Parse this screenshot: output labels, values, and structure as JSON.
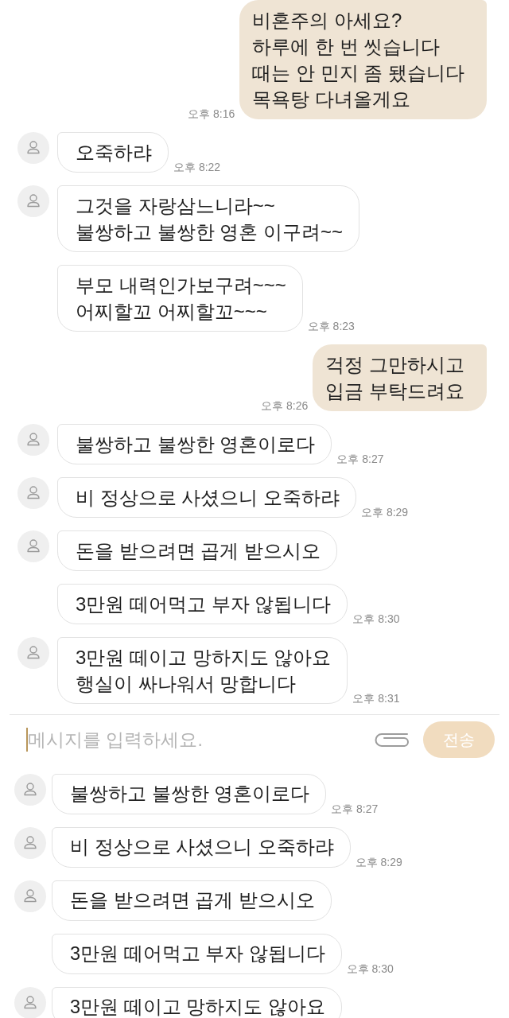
{
  "chat_top": {
    "messages": [
      {
        "kind": "sent",
        "text": "비혼주의 아세요?\n하루에 한 번 씻습니다\n때는 안 민지 좀 됐습니다\n목욕탕 다녀올게요",
        "time": "오후 8:16"
      },
      {
        "kind": "received",
        "avatar": true,
        "text": "오죽하랴",
        "time": "오후 8:22"
      },
      {
        "kind": "received",
        "avatar": true,
        "text": "그것을 자랑삼느니라~~\n불쌍하고 불쌍한 영혼 이구려~~"
      },
      {
        "kind": "received",
        "avatar": false,
        "text": "부모 내력인가보구려~~~\n어찌할꼬 어찌할꼬~~~",
        "time": "오후 8:23"
      },
      {
        "kind": "sent",
        "text": "걱정 그만하시고\n입금 부탁드려요",
        "time": "오후 8:26"
      },
      {
        "kind": "received",
        "avatar": true,
        "text": "불쌍하고 불쌍한 영혼이로다",
        "time": "오후 8:27"
      },
      {
        "kind": "received",
        "avatar": true,
        "text": "비 정상으로 사셨으니 오죽하랴",
        "time": "오후 8:29"
      },
      {
        "kind": "received",
        "avatar": true,
        "text": "돈을 받으려면 곱게 받으시오"
      },
      {
        "kind": "received",
        "avatar": false,
        "text": "3만원 떼어먹고 부자 않됩니다",
        "time": "오후 8:30"
      },
      {
        "kind": "received",
        "avatar": true,
        "text": "3만원 떼이고 망하지도 않아요\n행실이 싸나워서 망합니다",
        "time": "오후 8:31"
      }
    ]
  },
  "composer": {
    "placeholder": "메시지를 입력하세요.",
    "focused": true,
    "send_button": "전송"
  },
  "chat_bottom": {
    "messages": [
      {
        "kind": "received",
        "avatar": true,
        "text": "불쌍하고 불쌍한 영혼이로다",
        "time": "오후 8:27"
      },
      {
        "kind": "received",
        "avatar": true,
        "text": "비 정상으로 사셨으니 오죽하랴",
        "time": "오후 8:29"
      },
      {
        "kind": "received",
        "avatar": true,
        "text": "돈을 받으려면 곱게 받으시오"
      },
      {
        "kind": "received",
        "avatar": false,
        "text": "3만원 떼어먹고 부자 않됩니다",
        "time": "오후 8:30"
      },
      {
        "kind": "received",
        "avatar": true,
        "text": "3만원 떼이고 망하지도 않아요"
      }
    ]
  }
}
